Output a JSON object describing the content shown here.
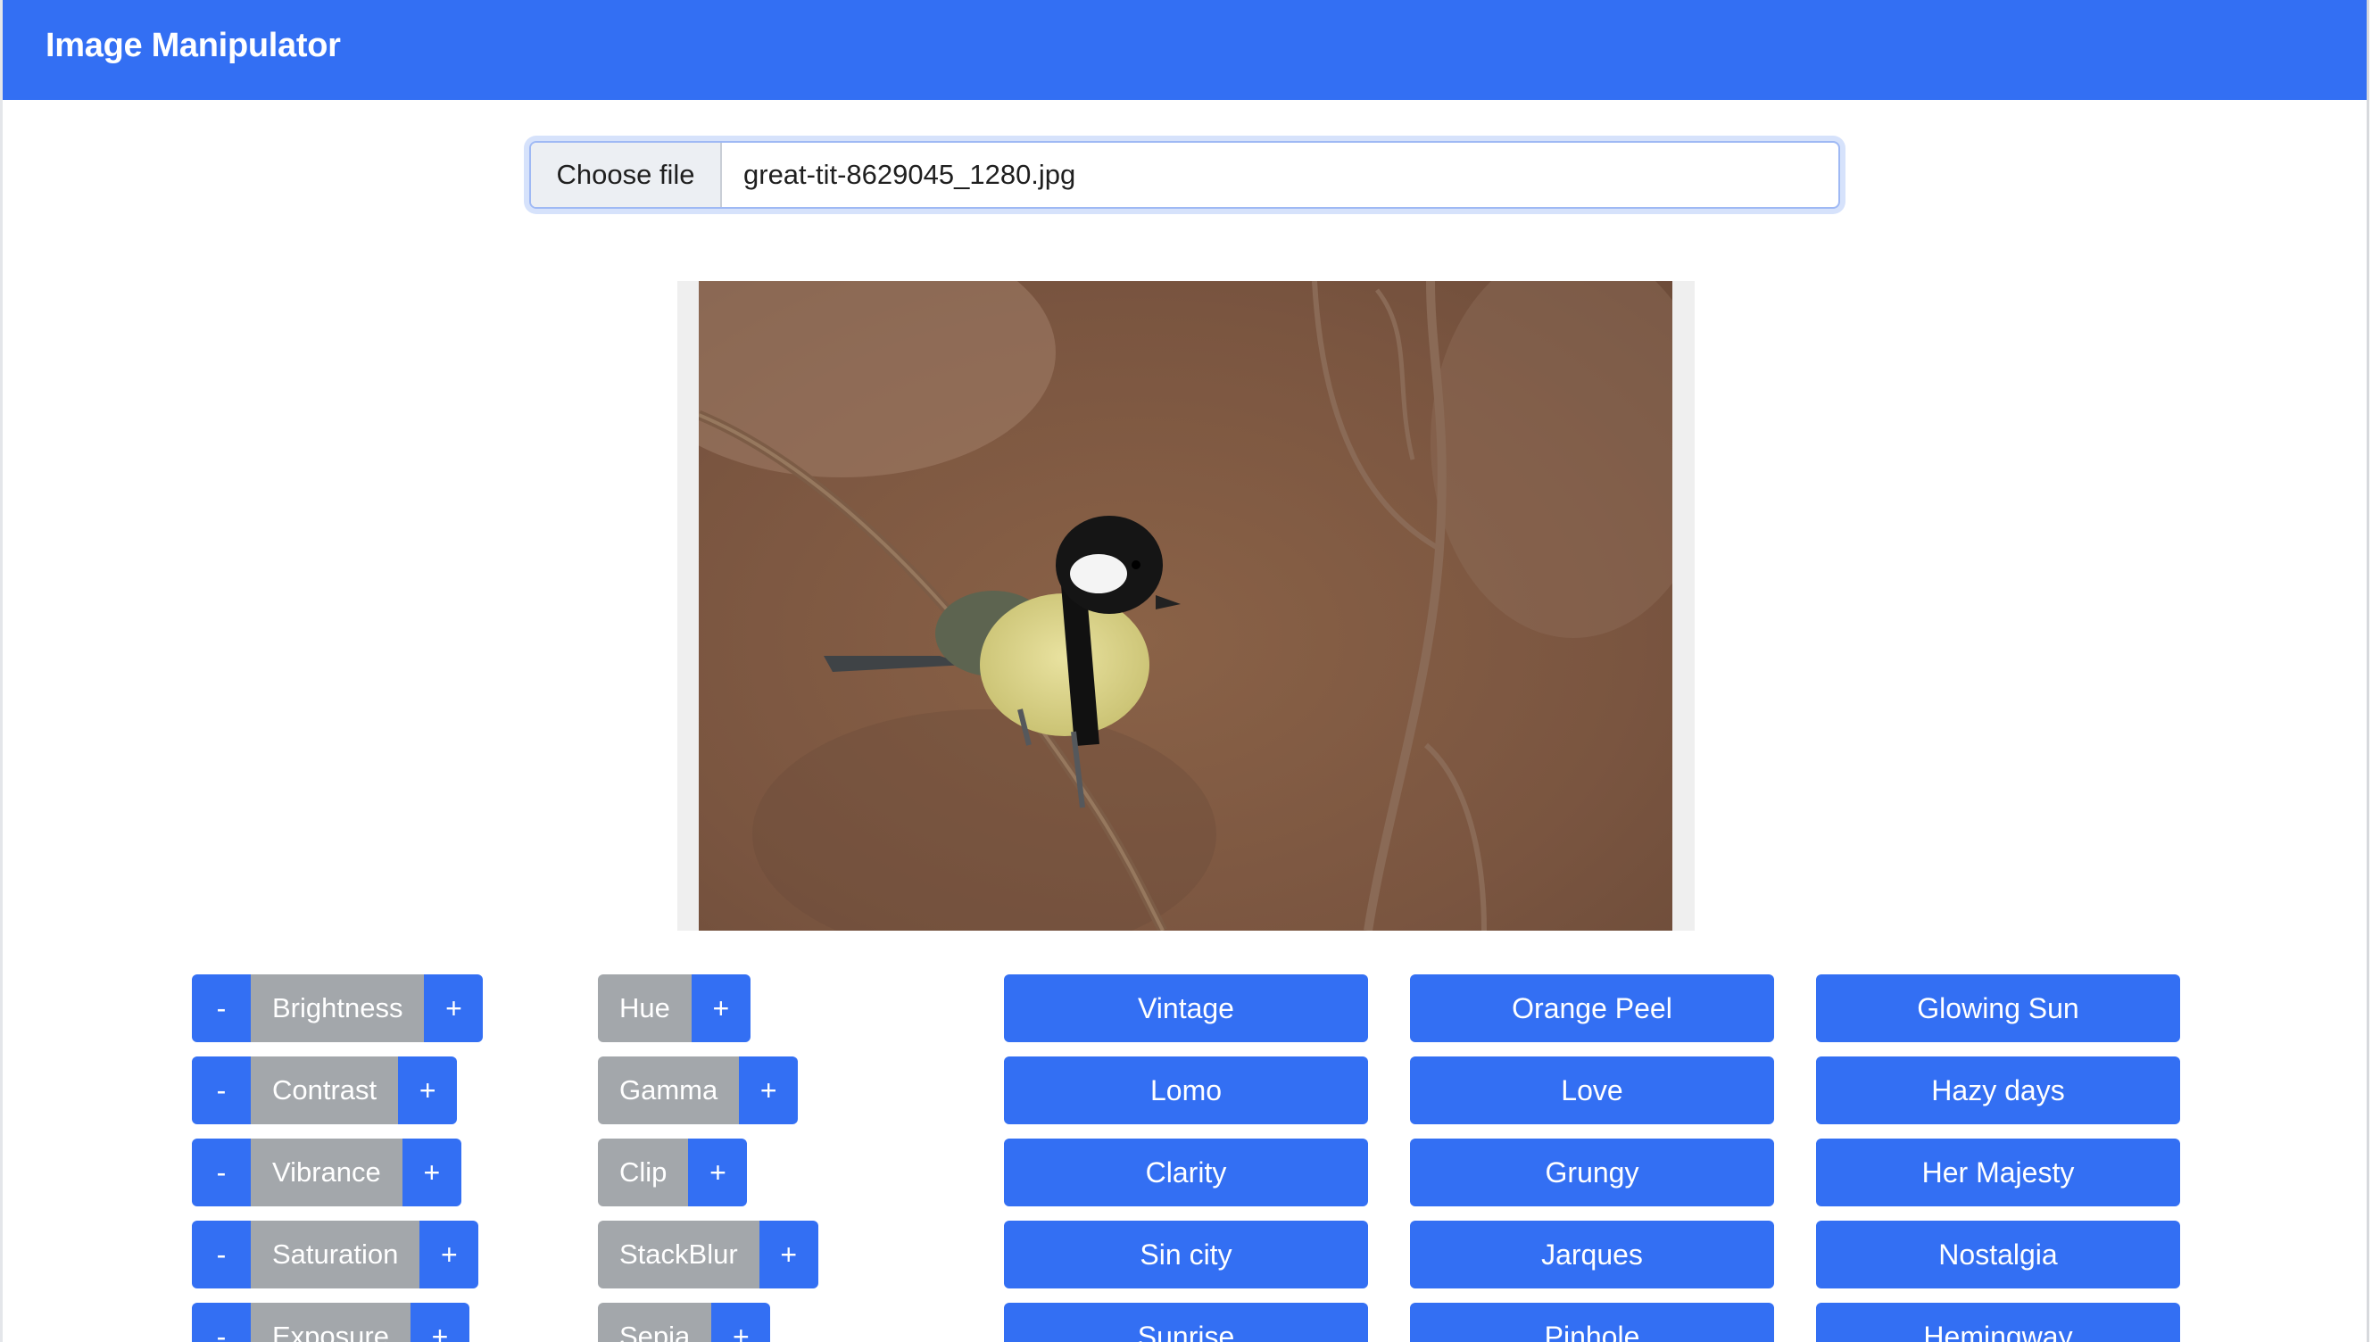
{
  "app": {
    "title": "Image Manipulator"
  },
  "file": {
    "button_label": "Choose file",
    "filename": "great-tit-8629045_1280.jpg"
  },
  "adjust_left": [
    {
      "minus": "-",
      "label": "Brightness",
      "plus": "+"
    },
    {
      "minus": "-",
      "label": "Contrast",
      "plus": "+"
    },
    {
      "minus": "-",
      "label": "Vibrance",
      "plus": "+"
    },
    {
      "minus": "-",
      "label": "Saturation",
      "plus": "+"
    },
    {
      "minus": "-",
      "label": "Exposure",
      "plus": "+"
    }
  ],
  "adjust_right": [
    {
      "label": "Hue",
      "plus": "+"
    },
    {
      "label": "Gamma",
      "plus": "+"
    },
    {
      "label": "Clip",
      "plus": "+"
    },
    {
      "label": "StackBlur",
      "plus": "+"
    },
    {
      "label": "Sepia",
      "plus": "+"
    }
  ],
  "presets": {
    "col1": [
      "Vintage",
      "Lomo",
      "Clarity",
      "Sin city",
      "Sunrise"
    ],
    "col2": [
      "Orange Peel",
      "Love",
      "Grungy",
      "Jarques",
      "Pinhole"
    ],
    "col3": [
      "Glowing Sun",
      "Hazy days",
      "Her Majesty",
      "Nostalgia",
      "Hemingway"
    ]
  },
  "colors": {
    "accent": "#336ff3",
    "gray_label": "#a3a7ab"
  }
}
